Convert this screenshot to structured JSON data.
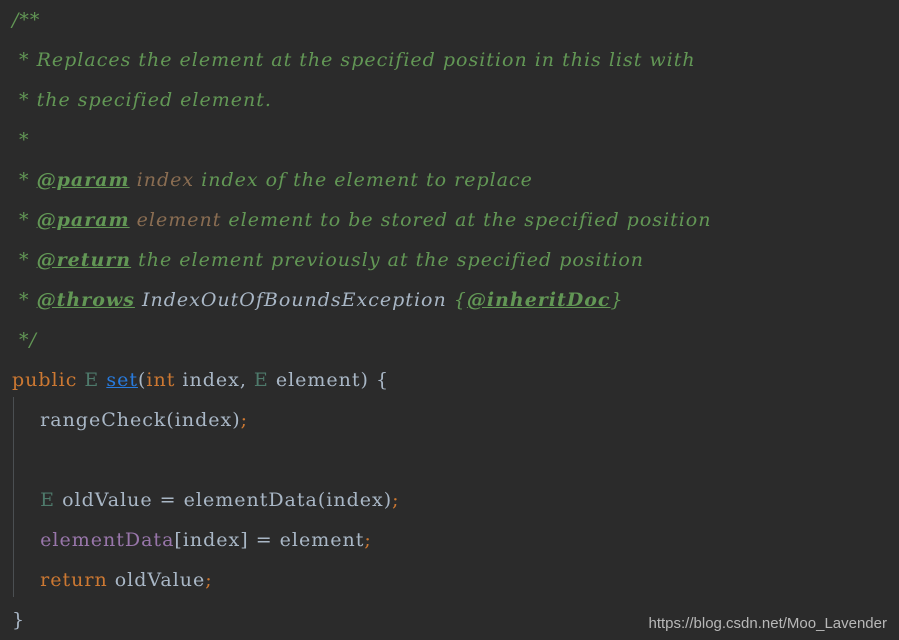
{
  "editor": {
    "theme_background": "#2b2b2b",
    "language": "java",
    "colors": {
      "comment_green": "#629755",
      "keyword_orange": "#cc7832",
      "plain_text": "#a9b7c6",
      "field_purple": "#9876aa",
      "method_blue": "#287bde",
      "type_teal": "#4e7a6b",
      "doc_param_brown": "#8a6d52",
      "indent_guide": "#4b4f52",
      "watermark_gray": "#b8b8b8"
    }
  },
  "code": {
    "lines": [
      {
        "n": 1,
        "kind": "comment",
        "tokens": [
          {
            "cls": "t-comment",
            "text": "/**"
          }
        ]
      },
      {
        "n": 2,
        "kind": "comment",
        "tokens": [
          {
            "cls": "t-comment",
            "text": " * "
          },
          {
            "cls": "t-doctext",
            "text": "Replaces the element at the specified position in this list with"
          }
        ]
      },
      {
        "n": 3,
        "kind": "comment",
        "tokens": [
          {
            "cls": "t-comment",
            "text": " * "
          },
          {
            "cls": "t-doctext",
            "text": "the specified element."
          }
        ]
      },
      {
        "n": 4,
        "kind": "comment",
        "tokens": [
          {
            "cls": "t-comment",
            "text": " *"
          }
        ]
      },
      {
        "n": 5,
        "kind": "comment",
        "tokens": [
          {
            "cls": "t-comment",
            "text": " * "
          },
          {
            "cls": "t-tag",
            "text": "@param"
          },
          {
            "cls": "t-doctext",
            "text": " "
          },
          {
            "cls": "t-paramname",
            "text": "index"
          },
          {
            "cls": "t-doctext",
            "text": " index of the element to replace"
          }
        ]
      },
      {
        "n": 6,
        "kind": "comment",
        "tokens": [
          {
            "cls": "t-comment",
            "text": " * "
          },
          {
            "cls": "t-tag",
            "text": "@param"
          },
          {
            "cls": "t-doctext",
            "text": " "
          },
          {
            "cls": "t-paramname",
            "text": "element"
          },
          {
            "cls": "t-doctext",
            "text": " element to be stored at the specified position"
          }
        ]
      },
      {
        "n": 7,
        "kind": "comment",
        "tokens": [
          {
            "cls": "t-comment",
            "text": " * "
          },
          {
            "cls": "t-tag",
            "text": "@return"
          },
          {
            "cls": "t-doctext",
            "text": " the element previously at the specified position"
          }
        ]
      },
      {
        "n": 8,
        "kind": "comment",
        "tokens": [
          {
            "cls": "t-comment",
            "text": " * "
          },
          {
            "cls": "t-tag",
            "text": "@throws"
          },
          {
            "cls": "t-doctext",
            "text": " "
          },
          {
            "cls": "t-doctype",
            "text": "IndexOutOfBoundsException"
          },
          {
            "cls": "t-doctext",
            "text": " "
          },
          {
            "cls": "t-brace-doc",
            "text": "{"
          },
          {
            "cls": "t-tag",
            "text": "@inheritDoc"
          },
          {
            "cls": "t-brace-doc",
            "text": "}"
          }
        ]
      },
      {
        "n": 9,
        "kind": "comment",
        "tokens": [
          {
            "cls": "t-comment",
            "text": " */"
          }
        ]
      },
      {
        "n": 10,
        "kind": "code",
        "tokens": [
          {
            "cls": "t-keyword",
            "text": "public"
          },
          {
            "cls": "t-plain",
            "text": " "
          },
          {
            "cls": "t-type",
            "text": "E"
          },
          {
            "cls": "t-plain",
            "text": " "
          },
          {
            "cls": "t-method-decl",
            "text": "set"
          },
          {
            "cls": "t-punct",
            "text": "("
          },
          {
            "cls": "t-keyword",
            "text": "int"
          },
          {
            "cls": "t-plain",
            "text": " index"
          },
          {
            "cls": "t-punct",
            "text": ", "
          },
          {
            "cls": "t-type",
            "text": "E"
          },
          {
            "cls": "t-plain",
            "text": " element"
          },
          {
            "cls": "t-punct",
            "text": ") {"
          }
        ]
      },
      {
        "n": 11,
        "kind": "code",
        "tokens": [
          {
            "cls": "t-plain",
            "text": "    rangeCheck(index)"
          },
          {
            "cls": "t-semi",
            "text": ";"
          }
        ]
      },
      {
        "n": 12,
        "kind": "code",
        "tokens": [
          {
            "cls": "t-plain",
            "text": ""
          }
        ]
      },
      {
        "n": 13,
        "kind": "code",
        "tokens": [
          {
            "cls": "t-plain",
            "text": "    "
          },
          {
            "cls": "t-type",
            "text": "E"
          },
          {
            "cls": "t-plain",
            "text": " oldValue = elementData(index)"
          },
          {
            "cls": "t-semi",
            "text": ";"
          }
        ]
      },
      {
        "n": 14,
        "kind": "code",
        "tokens": [
          {
            "cls": "t-plain",
            "text": "    "
          },
          {
            "cls": "t-field",
            "text": "elementData"
          },
          {
            "cls": "t-plain",
            "text": "[index] = element"
          },
          {
            "cls": "t-semi",
            "text": ";"
          }
        ]
      },
      {
        "n": 15,
        "kind": "code",
        "tokens": [
          {
            "cls": "t-plain",
            "text": "    "
          },
          {
            "cls": "t-keyword",
            "text": "return"
          },
          {
            "cls": "t-plain",
            "text": " oldValue"
          },
          {
            "cls": "t-semi",
            "text": ";"
          }
        ]
      },
      {
        "n": 16,
        "kind": "code",
        "tokens": [
          {
            "cls": "t-plain",
            "text": "}"
          }
        ]
      }
    ],
    "plain_text": "/**\n * Replaces the element at the specified position in this list with\n * the specified element.\n *\n * @param index index of the element to replace\n * @param element element to be stored at the specified position\n * @return the element previously at the specified position\n * @throws IndexOutOfBoundsException {@inheritDoc}\n */\npublic E set(int index, E element) {\n    rangeCheck(index);\n\n    E oldValue = elementData(index);\n    elementData[index] = element;\n    return oldValue;\n}"
  },
  "watermark": {
    "text": "https://blog.csdn.net/Moo_Lavender"
  }
}
